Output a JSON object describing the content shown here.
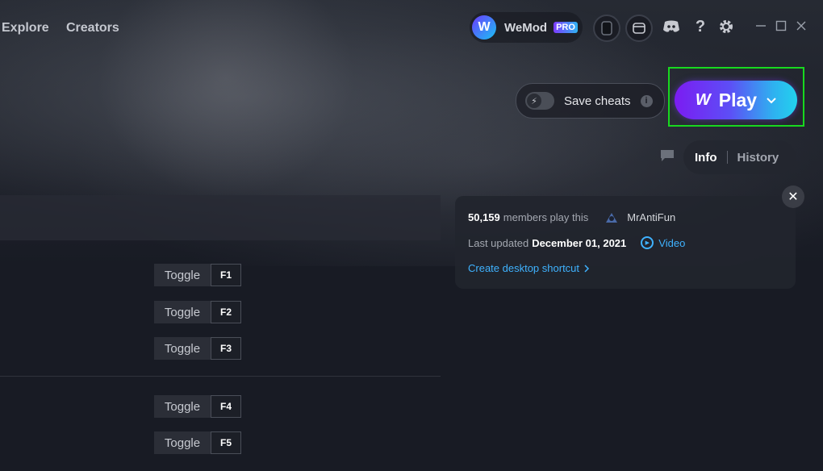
{
  "nav": {
    "explore_label": "Explore",
    "creators_label": "Creators"
  },
  "brand": {
    "name": "WeMod",
    "badge": "PRO",
    "logo_letter": "W"
  },
  "header_icons": [
    "avatar-icon",
    "overlay-icon",
    "discord-icon",
    "help-icon",
    "gear-icon"
  ],
  "window_controls": [
    "minimize-icon",
    "maximize-icon",
    "close-icon"
  ],
  "save_cheats": {
    "label": "Save cheats",
    "enabled": false
  },
  "play_button": {
    "label": "Play",
    "logo": "W"
  },
  "tabs": {
    "info": "Info",
    "history": "History",
    "active": "Info"
  },
  "info_card": {
    "members_count": "50,159",
    "members_text": "members play this",
    "creator": "MrAntiFun",
    "last_updated_label": "Last updated",
    "last_updated_date": "December 01, 2021",
    "video_label": "Video",
    "shortcut_label": "Create desktop shortcut"
  },
  "cheats": [
    {
      "action": "Toggle",
      "key": "F1"
    },
    {
      "action": "Toggle",
      "key": "F2"
    },
    {
      "action": "Toggle",
      "key": "F3"
    },
    {
      "action": "Toggle",
      "key": "F4"
    },
    {
      "action": "Toggle",
      "key": "F5"
    }
  ],
  "colors": {
    "background": "#181b24",
    "accent_blue": "#3fb2ff",
    "play_gradient_start": "#7b1cf2",
    "play_gradient_end": "#22d2ee",
    "highlight_frame": "#18d91f"
  }
}
